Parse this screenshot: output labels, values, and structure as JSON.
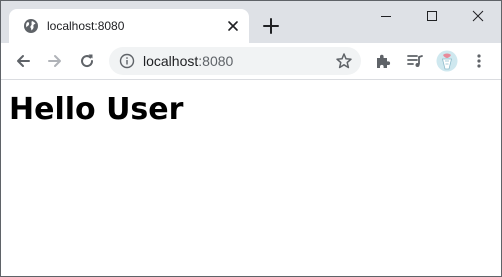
{
  "tab": {
    "title": "localhost:8080",
    "favicon": "globe-icon"
  },
  "address_bar": {
    "host": "localhost",
    "port": ":8080"
  },
  "page": {
    "heading": "Hello User"
  },
  "colors": {
    "tabstrip_bg": "#dee1e6",
    "omnibox_bg": "#f1f3f4",
    "icon": "#5f6368",
    "icon_disabled": "#b0b3b8",
    "text": "#202124"
  }
}
